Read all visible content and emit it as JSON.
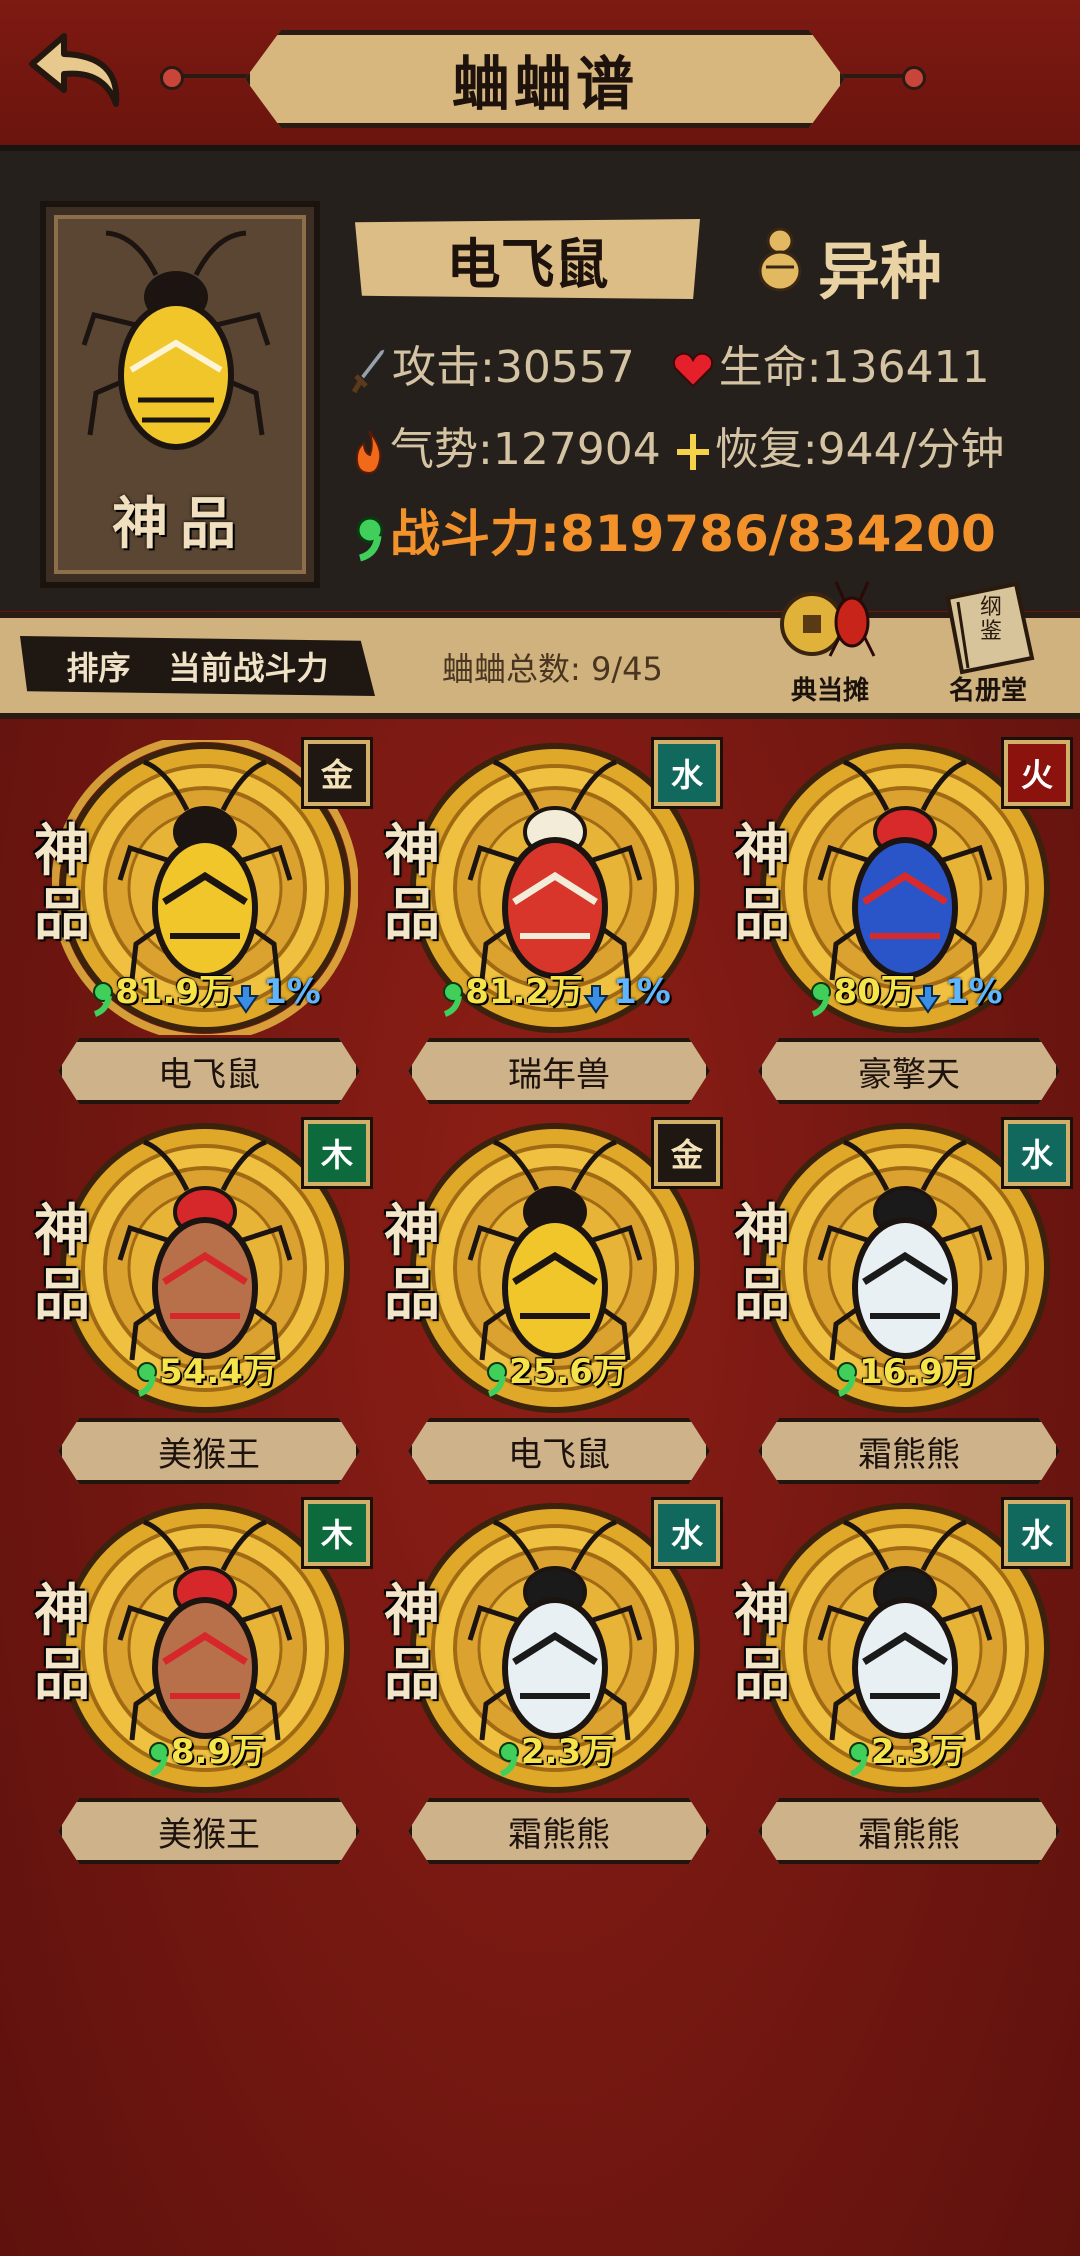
{
  "header": {
    "title": "蛐蛐谱"
  },
  "detail": {
    "grade": "神品",
    "name": "电飞鼠",
    "variant": "异种",
    "attack": "攻击:30557",
    "hp": "生命:136411",
    "momentum": "气势:127904",
    "recovery": "恢复:944/分钟",
    "combat_power": "战斗力:819786/834200"
  },
  "sortbar": {
    "sort_label": "排序",
    "sort_value": "当前战斗力",
    "total_count": "蛐蛐总数: 9/45",
    "pawn_shop": "典当摊",
    "roster_hall": "名册堂",
    "book_cover_text": "纲鉴"
  },
  "grade_chars": [
    "神",
    "品"
  ],
  "crickets": [
    {
      "name": "电飞鼠",
      "element": "金",
      "elem_class": "gold",
      "power": "81.9万",
      "pct": "1%",
      "body": "#f0c62a",
      "accent": "#1c1410",
      "selected": true
    },
    {
      "name": "瑞年兽",
      "element": "水",
      "elem_class": "water",
      "power": "81.2万",
      "pct": "1%",
      "body": "#d8362a",
      "accent": "#f2ecd8",
      "selected": false
    },
    {
      "name": "豪擎天",
      "element": "火",
      "elem_class": "fire",
      "power": "80万",
      "pct": "1%",
      "body": "#2a55c8",
      "accent": "#d82a2a",
      "selected": false
    },
    {
      "name": "美猴王",
      "element": "木",
      "elem_class": "wood",
      "power": "54.4万",
      "pct": "",
      "body": "#b8704a",
      "accent": "#d6282a",
      "selected": false
    },
    {
      "name": "电飞鼠",
      "element": "金",
      "elem_class": "gold",
      "power": "25.6万",
      "pct": "",
      "body": "#f0c62a",
      "accent": "#1c1410",
      "selected": false
    },
    {
      "name": "霜熊熊",
      "element": "水",
      "elem_class": "water",
      "power": "16.9万",
      "pct": "",
      "body": "#e8f0f4",
      "accent": "#1a1a1a",
      "selected": false
    },
    {
      "name": "美猴王",
      "element": "木",
      "elem_class": "wood",
      "power": "8.9万",
      "pct": "",
      "body": "#b8704a",
      "accent": "#d6282a",
      "selected": false
    },
    {
      "name": "霜熊熊",
      "element": "水",
      "elem_class": "water",
      "power": "2.3万",
      "pct": "",
      "body": "#e8f0f4",
      "accent": "#1a1a1a",
      "selected": false
    },
    {
      "name": "霜熊熊",
      "element": "水",
      "elem_class": "water",
      "power": "2.3万",
      "pct": "",
      "body": "#e8f0f4",
      "accent": "#1a1a1a",
      "selected": false
    }
  ]
}
